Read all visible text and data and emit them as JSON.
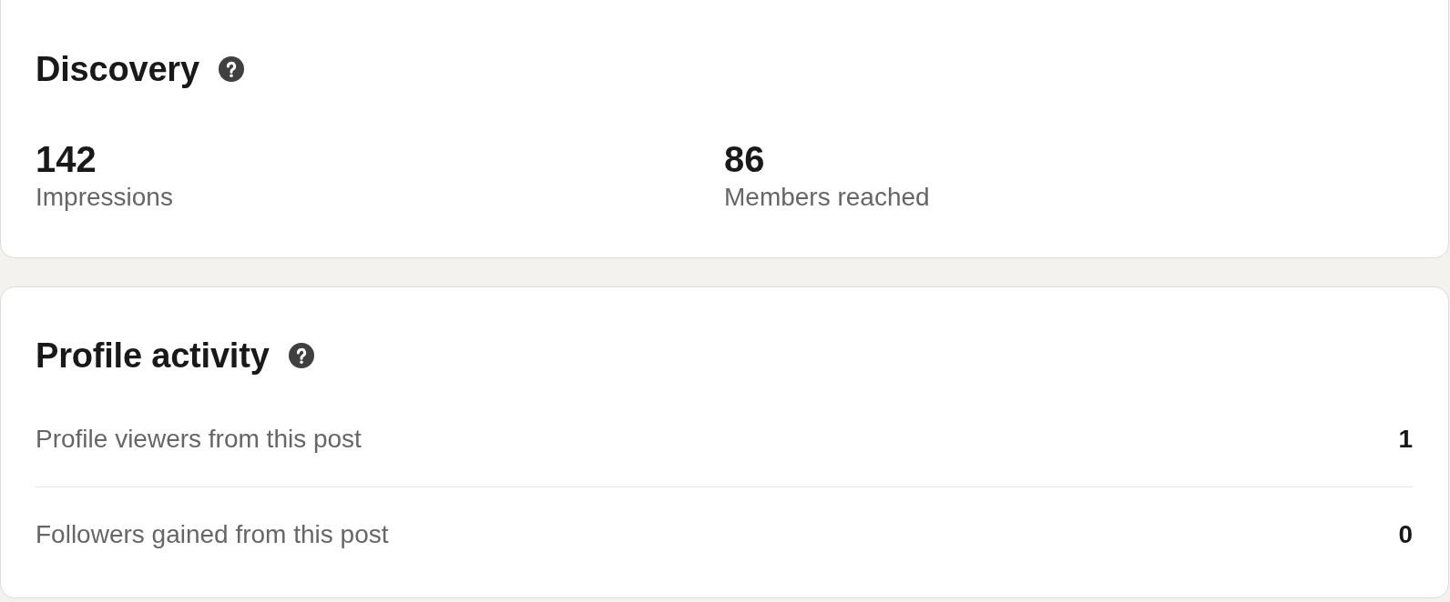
{
  "discovery": {
    "title": "Discovery",
    "metrics": [
      {
        "value": "142",
        "label": "Impressions"
      },
      {
        "value": "86",
        "label": "Members reached"
      }
    ]
  },
  "profile_activity": {
    "title": "Profile activity",
    "rows": [
      {
        "label": "Profile viewers from this post",
        "value": "1"
      },
      {
        "label": "Followers gained from this post",
        "value": "0"
      }
    ]
  }
}
